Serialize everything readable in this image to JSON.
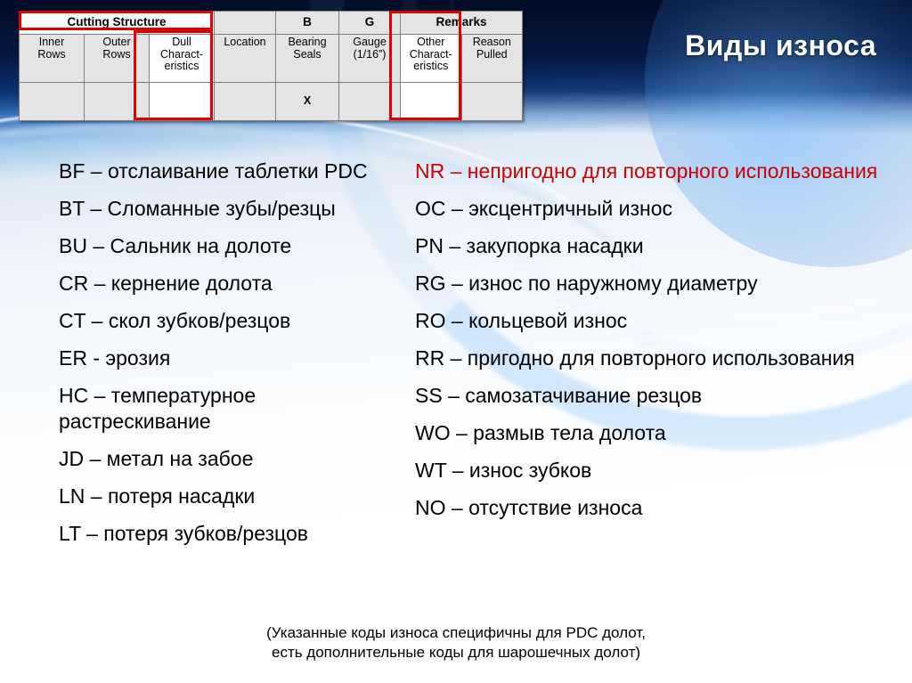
{
  "slide": {
    "title": "Виды износа",
    "title_color": "#ffffff",
    "accent_color": "#cc0000",
    "background_colors": {
      "top_navy": "#03133a",
      "mid_blue": "#2f6fbf",
      "body_white": "#ffffff",
      "swoosh": "#78b9f5"
    }
  },
  "dull_table": {
    "group_headers": [
      {
        "label": "Cutting Structure",
        "colspan": 3,
        "highlighted": true
      },
      {
        "label": "",
        "colspan": 1,
        "highlighted": false
      },
      {
        "label": "B",
        "colspan": 1,
        "highlighted": false
      },
      {
        "label": "G",
        "colspan": 1,
        "highlighted": false
      },
      {
        "label": "Remarks",
        "colspan": 2,
        "highlighted": false
      }
    ],
    "column_headers": [
      {
        "label": "Inner\nRows",
        "highlighted": false
      },
      {
        "label": "Outer\nRows",
        "highlighted": false
      },
      {
        "label": "Dull\nCharact-\neristics",
        "highlighted": true
      },
      {
        "label": "Location",
        "highlighted": false
      },
      {
        "label": "Bearing\nSeals",
        "highlighted": false
      },
      {
        "label": "Gauge\n(1/16”)",
        "highlighted": false
      },
      {
        "label": "Other\nCharact-\neristics",
        "highlighted": true
      },
      {
        "label": "Reason\nPulled",
        "highlighted": false
      }
    ],
    "data_row": [
      {
        "value": "",
        "highlighted": false
      },
      {
        "value": "",
        "highlighted": false
      },
      {
        "value": "",
        "highlighted": true
      },
      {
        "value": "",
        "highlighted": false
      },
      {
        "value": "X",
        "highlighted": false
      },
      {
        "value": "",
        "highlighted": false
      },
      {
        "value": "",
        "highlighted": true
      },
      {
        "value": "",
        "highlighted": false
      }
    ]
  },
  "codes": {
    "left_column": [
      {
        "code": "BF",
        "text": "BF – отслаивание таблетки PDC",
        "accent": false
      },
      {
        "code": "BT",
        "text": "BT – Сломанные зубы/резцы",
        "accent": false
      },
      {
        "code": "BU",
        "text": "BU – Сальник на долоте",
        "accent": false
      },
      {
        "code": "CR",
        "text": "CR – кернение долота",
        "accent": false
      },
      {
        "code": "CT",
        "text": "CT – скол зубков/резцов",
        "accent": false
      },
      {
        "code": "ER",
        "text": "ER - эрозия",
        "accent": false
      },
      {
        "code": "HC",
        "text": "HC – температурное растрескивание",
        "accent": false
      },
      {
        "code": "JD",
        "text": "JD – метал на забое",
        "accent": false
      },
      {
        "code": "LN",
        "text": "LN – потеря насадки",
        "accent": false
      },
      {
        "code": "LT",
        "text": "LT – потеря зубков/резцов",
        "accent": false
      }
    ],
    "right_column": [
      {
        "code": "NR",
        "text": "NR – непригодно для повторного использования",
        "accent": true
      },
      {
        "code": "OC",
        "text": "OC – эксцентричный износ",
        "accent": false
      },
      {
        "code": "PN",
        "text": "PN – закупорка насадки",
        "accent": false
      },
      {
        "code": "RG",
        "text": "RG – износ по наружному диаметру",
        "accent": false
      },
      {
        "code": "RO",
        "text": "RO – кольцевой износ",
        "accent": false
      },
      {
        "code": "RR",
        "text": "RR – пригодно для повторного использования",
        "accent": false
      },
      {
        "code": "SS",
        "text": "SS – самозатачивание резцов",
        "accent": false
      },
      {
        "code": "WO",
        "text": "WO – размыв тела долота",
        "accent": false
      },
      {
        "code": "WT",
        "text": "WT – износ зубков",
        "accent": false
      },
      {
        "code": "NO",
        "text": "NO – отсутствие износа",
        "accent": false
      }
    ]
  },
  "footer": {
    "line1": "(Указанные коды износа специфичны для PDC долот,",
    "line2": "есть дополнительные коды для шарошечных долот)"
  }
}
